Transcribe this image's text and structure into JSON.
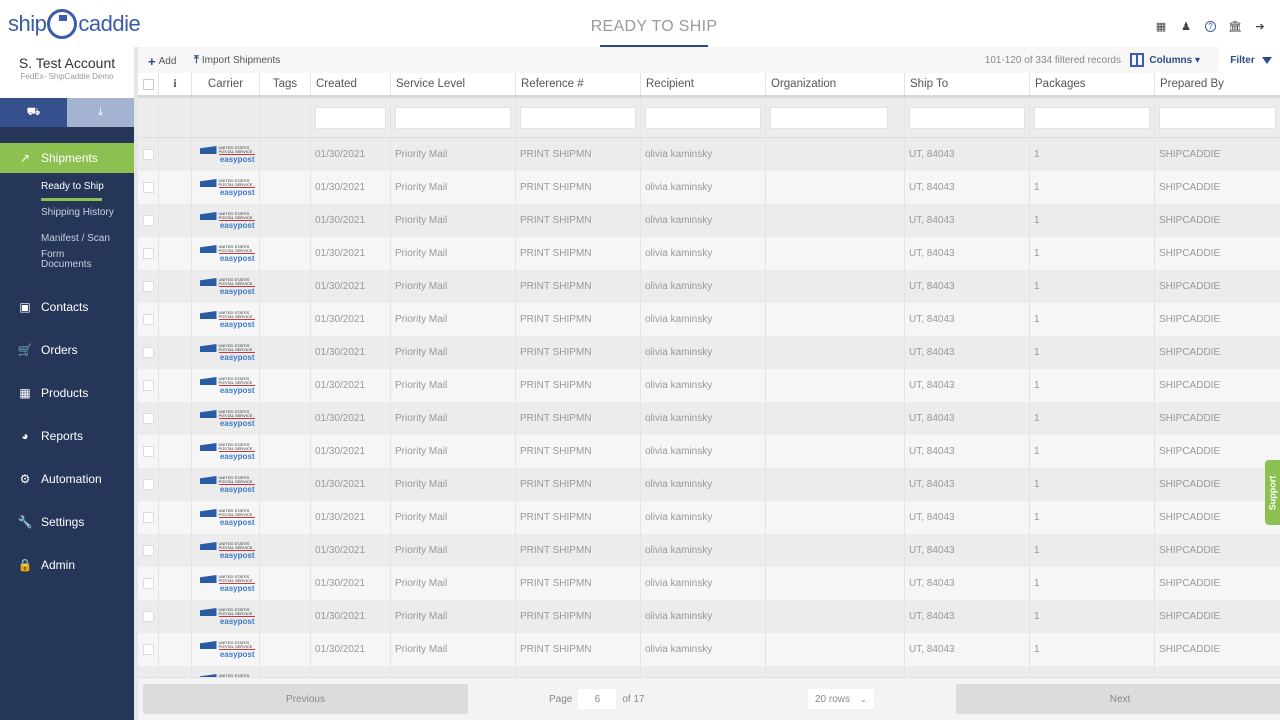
{
  "app": {
    "logo_text_left": "ship",
    "logo_text_right": "caddie",
    "page_title": "READY TO SHIP"
  },
  "top_icons": [
    {
      "name": "calculator-icon",
      "glyph": "▦"
    },
    {
      "name": "user-icon",
      "glyph": "♟"
    },
    {
      "name": "help-icon",
      "glyph": "?"
    },
    {
      "name": "bank-icon",
      "glyph": "🏛"
    },
    {
      "name": "logout-icon",
      "glyph": "➔"
    }
  ],
  "account": {
    "name": "S. Test Account",
    "subtitle": "FedEx- ShipCaddie Demo"
  },
  "sidebar": {
    "tabs": [
      {
        "name": "truck-icon",
        "glyph": "⛟"
      },
      {
        "name": "download-icon",
        "glyph": "⤓"
      }
    ],
    "active": {
      "label": "Shipments",
      "icon": "shipments-icon",
      "glyph": "↗"
    },
    "sub_items": [
      {
        "label": "Ready to Ship",
        "current": true
      },
      {
        "label": "Shipping History",
        "current": false
      },
      {
        "label": "Manifest / Scan Form",
        "current": false
      },
      {
        "label": "Documents",
        "current": false
      }
    ],
    "items": [
      {
        "label": "Contacts",
        "icon": "contacts-icon",
        "glyph": "▣"
      },
      {
        "label": "Orders",
        "icon": "cart-icon",
        "glyph": "🛒"
      },
      {
        "label": "Products",
        "icon": "grid-icon",
        "glyph": "▦"
      },
      {
        "label": "Reports",
        "icon": "pie-chart-icon",
        "glyph": "◕"
      },
      {
        "label": "Automation",
        "icon": "cogs-icon",
        "glyph": "⚙"
      },
      {
        "label": "Settings",
        "icon": "wrench-icon",
        "glyph": "🔧"
      },
      {
        "label": "Admin",
        "icon": "lock-icon",
        "glyph": "🔒"
      }
    ]
  },
  "toolbar": {
    "add_label": "Add",
    "import_label": "Import Shipments",
    "records": "101-120 of 334 filtered records",
    "columns_label": "Columns ▾",
    "filter_label": "Filter"
  },
  "table": {
    "headers": [
      "",
      "i",
      "Carrier",
      "Tags",
      "Created",
      "Service Level",
      "Reference #",
      "Recipient",
      "Organization",
      "Ship To",
      "Packages",
      "Prepared By"
    ],
    "carrier_logo": {
      "line1": "UNITED STATES",
      "line2": "POSTAL SERVICE",
      "brand": "easypost"
    },
    "rows": [
      {
        "created": "01/30/2021",
        "service": "Priority Mail",
        "reference": "PRINT SHIPMN",
        "recipient": "olivia kaminsky",
        "organization": "",
        "ship_to": "UT, 84043",
        "packages": "1",
        "prepared_by": "SHIPCADDIE"
      },
      {
        "created": "01/30/2021",
        "service": "Priority Mail",
        "reference": "PRINT SHIPMN",
        "recipient": "olivia kaminsky",
        "organization": "",
        "ship_to": "UT, 84043",
        "packages": "1",
        "prepared_by": "SHIPCADDIE"
      },
      {
        "created": "01/30/2021",
        "service": "Priority Mail",
        "reference": "PRINT SHIPMN",
        "recipient": "olivia kaminsky",
        "organization": "",
        "ship_to": "UT, 84043",
        "packages": "1",
        "prepared_by": "SHIPCADDIE"
      },
      {
        "created": "01/30/2021",
        "service": "Priority Mail",
        "reference": "PRINT SHIPMN",
        "recipient": "olivia kaminsky",
        "organization": "",
        "ship_to": "UT, 84043",
        "packages": "1",
        "prepared_by": "SHIPCADDIE"
      },
      {
        "created": "01/30/2021",
        "service": "Priority Mail",
        "reference": "PRINT SHIPMN",
        "recipient": "olivia kaminsky",
        "organization": "",
        "ship_to": "UT, 84043",
        "packages": "1",
        "prepared_by": "SHIPCADDIE"
      },
      {
        "created": "01/30/2021",
        "service": "Priority Mail",
        "reference": "PRINT SHIPMN",
        "recipient": "olivia kaminsky",
        "organization": "",
        "ship_to": "UT, 84043",
        "packages": "1",
        "prepared_by": "SHIPCADDIE"
      },
      {
        "created": "01/30/2021",
        "service": "Priority Mail",
        "reference": "PRINT SHIPMN",
        "recipient": "olivia kaminsky",
        "organization": "",
        "ship_to": "UT, 84043",
        "packages": "1",
        "prepared_by": "SHIPCADDIE"
      },
      {
        "created": "01/30/2021",
        "service": "Priority Mail",
        "reference": "PRINT SHIPMN",
        "recipient": "olivia kaminsky",
        "organization": "",
        "ship_to": "UT, 84043",
        "packages": "1",
        "prepared_by": "SHIPCADDIE"
      },
      {
        "created": "01/30/2021",
        "service": "Priority Mail",
        "reference": "PRINT SHIPMN",
        "recipient": "olivia kaminsky",
        "organization": "",
        "ship_to": "UT, 84043",
        "packages": "1",
        "prepared_by": "SHIPCADDIE"
      },
      {
        "created": "01/30/2021",
        "service": "Priority Mail",
        "reference": "PRINT SHIPMN",
        "recipient": "olivia kaminsky",
        "organization": "",
        "ship_to": "UT, 84043",
        "packages": "1",
        "prepared_by": "SHIPCADDIE"
      },
      {
        "created": "01/30/2021",
        "service": "Priority Mail",
        "reference": "PRINT SHIPMN",
        "recipient": "olivia kaminsky",
        "organization": "",
        "ship_to": "UT, 84043",
        "packages": "1",
        "prepared_by": "SHIPCADDIE"
      },
      {
        "created": "01/30/2021",
        "service": "Priority Mail",
        "reference": "PRINT SHIPMN",
        "recipient": "olivia kaminsky",
        "organization": "",
        "ship_to": "UT, 84043",
        "packages": "1",
        "prepared_by": "SHIPCADDIE"
      },
      {
        "created": "01/30/2021",
        "service": "Priority Mail",
        "reference": "PRINT SHIPMN",
        "recipient": "olivia kaminsky",
        "organization": "",
        "ship_to": "UT, 84043",
        "packages": "1",
        "prepared_by": "SHIPCADDIE"
      },
      {
        "created": "01/30/2021",
        "service": "Priority Mail",
        "reference": "PRINT SHIPMN",
        "recipient": "olivia kaminsky",
        "organization": "",
        "ship_to": "UT, 84043",
        "packages": "1",
        "prepared_by": "SHIPCADDIE"
      },
      {
        "created": "01/30/2021",
        "service": "Priority Mail",
        "reference": "PRINT SHIPMN",
        "recipient": "olivia kaminsky",
        "organization": "",
        "ship_to": "UT, 84043",
        "packages": "1",
        "prepared_by": "SHIPCADDIE"
      },
      {
        "created": "01/30/2021",
        "service": "Priority Mail",
        "reference": "PRINT SHIPMN",
        "recipient": "olivia kaminsky",
        "organization": "",
        "ship_to": "UT, 84043",
        "packages": "1",
        "prepared_by": "SHIPCADDIE"
      },
      {
        "created": "01/30/2021",
        "service": "Priority Mail",
        "reference": "PRINT SHIPMN",
        "recipient": "olivia kaminsky",
        "organization": "",
        "ship_to": "UT, 84043",
        "packages": "1",
        "prepared_by": "SHIPCADDIE"
      }
    ]
  },
  "pagination": {
    "previous_label": "Previous",
    "next_label": "Next",
    "page_label": "Page",
    "page_value": "6",
    "of_label": "of 17",
    "rows_option": "20 rows"
  },
  "support_label": "Support",
  "colors": {
    "sidebar_bg": "#253659",
    "accent_green": "#8cc152",
    "brand_blue": "#2d4a8a"
  }
}
